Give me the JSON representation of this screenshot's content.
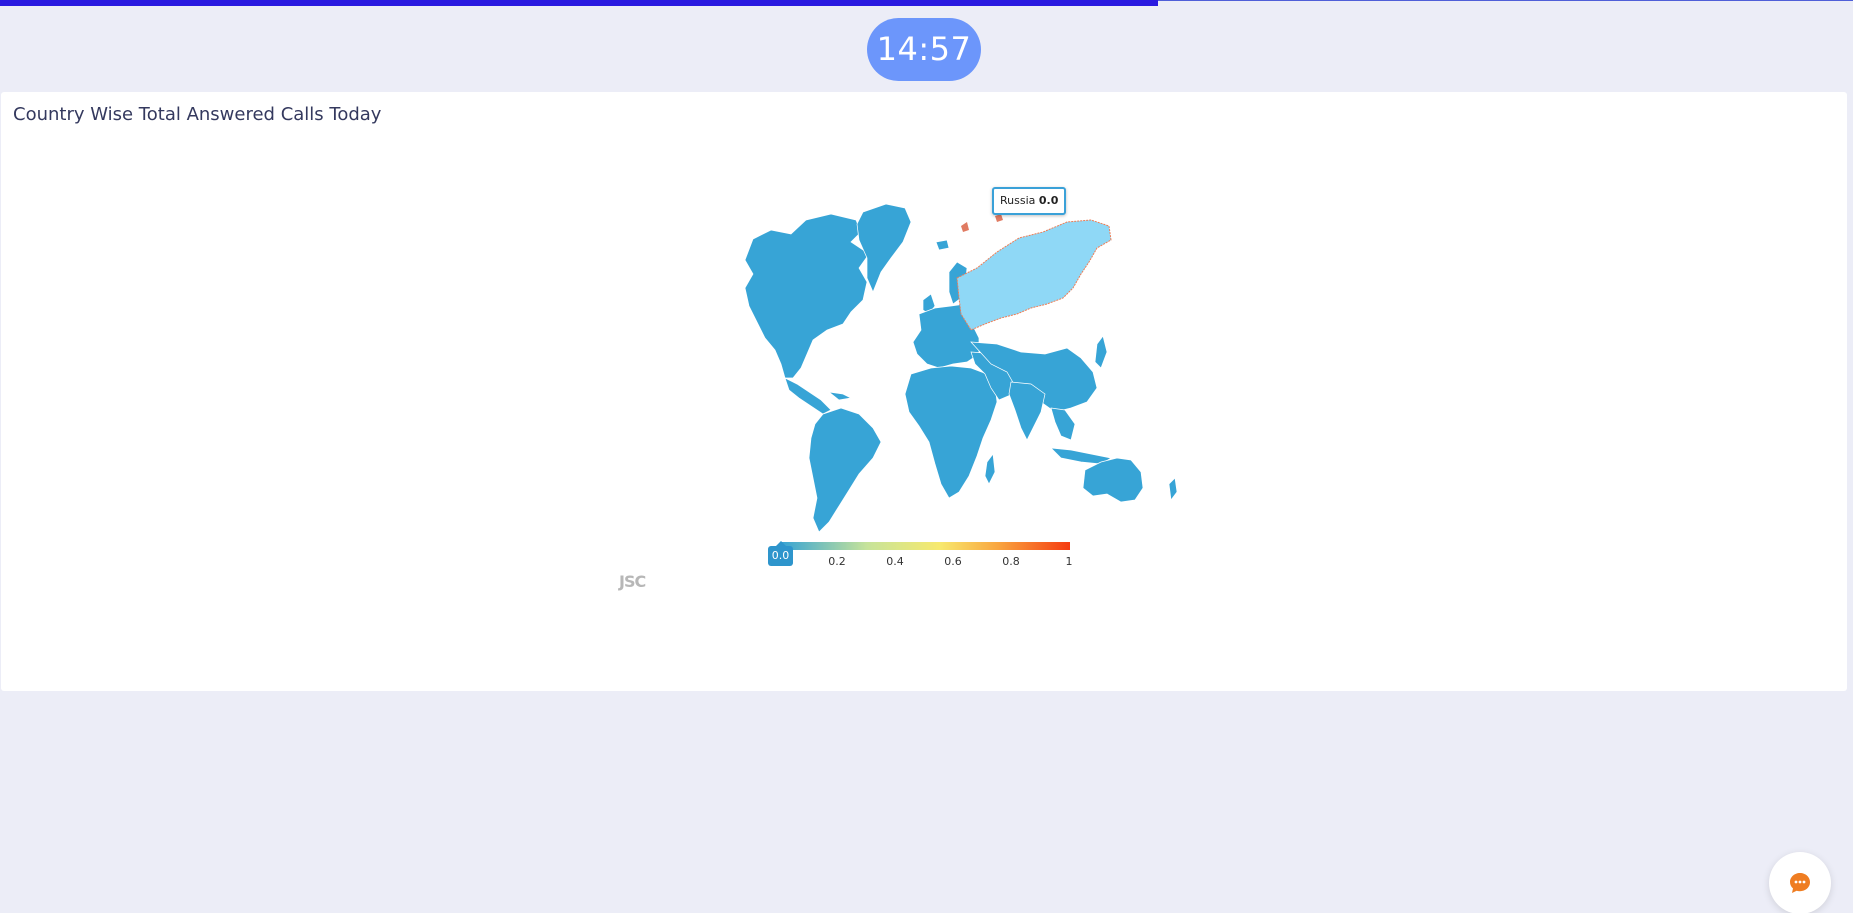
{
  "header": {
    "progress": 0.625,
    "timer": "14:57",
    "colors": {
      "progress": "#2a1ae0",
      "timer_bg": "#6c96fb"
    }
  },
  "card": {
    "title": "Country Wise Total Answered Calls Today"
  },
  "map": {
    "tooltip_country": "Russia",
    "tooltip_value": "0.0",
    "legend_ticks": [
      "0.2",
      "0.4",
      "0.6",
      "0.8",
      "1"
    ],
    "legend_selected": "0.0",
    "watermark": "JSC",
    "colors": {
      "land": "#37a4d6",
      "highlight": "#8fd8f6",
      "border": "#ffffff"
    }
  },
  "chat": {
    "icon": "chat-bubble-icon",
    "color": "#ef7d22"
  }
}
